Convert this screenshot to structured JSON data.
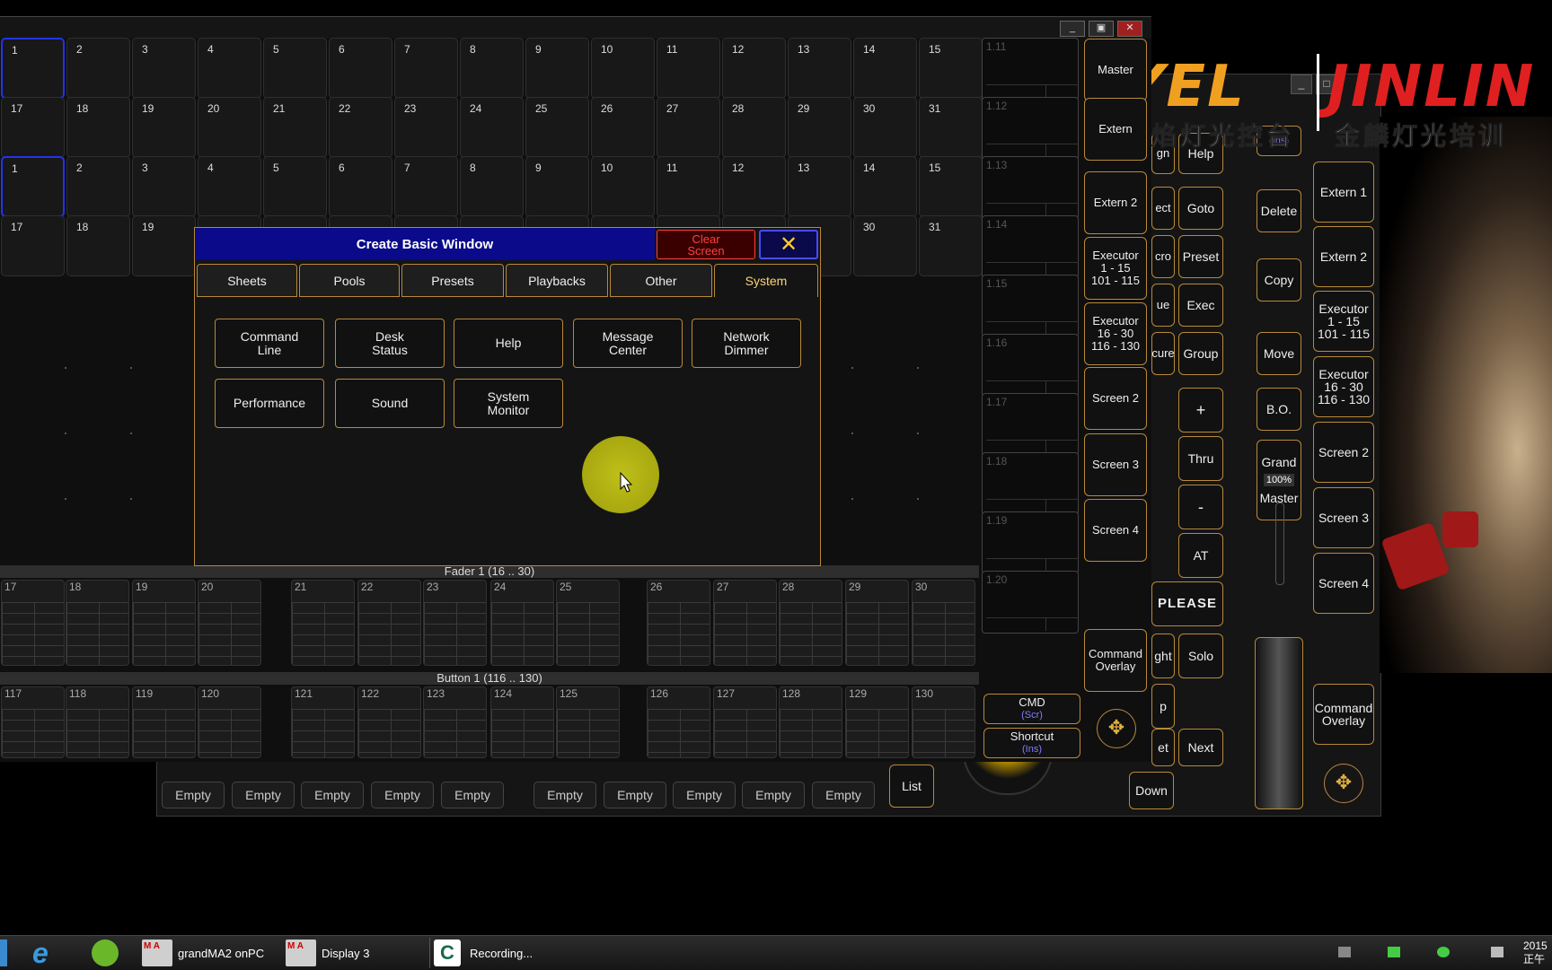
{
  "background_window": {
    "buttons": [
      {
        "label": "Master",
        "col": "a"
      },
      {
        "label": "Extern",
        "col": "a"
      },
      {
        "label": "Help",
        "col": "b"
      },
      {
        "label": "Delete",
        "col": "c"
      },
      {
        "label": "Extern 1",
        "col": "d"
      }
    ],
    "mid_labels": [
      "gn",
      "ect",
      "cro",
      "ue",
      "cure"
    ],
    "right_col": [
      "Help",
      "Goto",
      "Preset",
      "Exec",
      "Group",
      "+",
      "Thru",
      "-",
      "AT"
    ],
    "delete_col": [
      "Delete",
      "Copy",
      "Move",
      "B.O."
    ],
    "grand_master": {
      "top": "Grand",
      "pct": "100%",
      "bottom": "Master"
    },
    "extern_col": [
      "Extern 1",
      "Extern 2",
      "Executor\n1 - 15\n101 - 115",
      "Executor\n16 - 30\n116 - 130",
      "Screen 2",
      "Screen 3",
      "Screen 4"
    ],
    "command_overlay": "Command\nOverlay",
    "please": "PLEASE",
    "solo_row": [
      "ght",
      "Solo"
    ],
    "next_row": [
      "et",
      "Next"
    ],
    "p_label": "p",
    "down": "Down",
    "list": "List",
    "ins_label": "(Ins)",
    "macros_label": "Macros",
    "empty_label": "Empty",
    "empty_count": 10
  },
  "logo": {
    "left_big": "YEL",
    "right_big": "JINLIN",
    "left_sub": "领焰灯光控台",
    "right_sub": "金麟灯光培训"
  },
  "main_window": {
    "grid_rows": [
      [
        "1",
        "2",
        "3",
        "4",
        "5",
        "6",
        "7",
        "8",
        "9",
        "10",
        "11",
        "12",
        "13",
        "14",
        "15"
      ],
      [
        "17",
        "18",
        "19",
        "20",
        "21",
        "22",
        "23",
        "24",
        "25",
        "26",
        "27",
        "28",
        "29",
        "30",
        "31"
      ],
      [
        "1",
        "2",
        "3",
        "4",
        "5",
        "6",
        "7",
        "8",
        "9",
        "10",
        "11",
        "12",
        "13",
        "14",
        "15"
      ],
      [
        "17",
        "18",
        "19",
        "",
        "",
        "",
        "",
        "",
        "",
        "",
        "",
        "",
        "",
        "30",
        "31"
      ]
    ],
    "executor_labels": [
      "1.11",
      "1.12",
      "1.13",
      "1.14",
      "1.15",
      "1.16",
      "1.17",
      "1.18",
      "1.19",
      "1.20"
    ],
    "side_buttons": [
      "Master",
      "Extern",
      "Extern 2",
      "Executor\n1 - 15\n101 - 115",
      "Executor\n16 - 30\n116 - 130",
      "Screen 2",
      "Screen 3",
      "Screen 4",
      "Command\nOverlay"
    ],
    "cmd": {
      "label": "CMD",
      "sub": "(Scr)"
    },
    "shortcut": {
      "label": "Shortcut",
      "sub": "(Ins)"
    },
    "fader_header": "Fader  1 (16 .. 30)",
    "fader_labels": [
      "17",
      "18",
      "19",
      "20",
      "21",
      "22",
      "23",
      "24",
      "25",
      "26",
      "27",
      "28",
      "29",
      "30"
    ],
    "button_header": "Button  1 (116 .. 130)",
    "button_labels": [
      "117",
      "118",
      "119",
      "120",
      "121",
      "122",
      "123",
      "124",
      "125",
      "126",
      "127",
      "128",
      "129",
      "130"
    ]
  },
  "dialog": {
    "title": "Create Basic Window",
    "clear_screen": "Clear\nScreen",
    "tabs": [
      "Sheets",
      "Pools",
      "Presets",
      "Playbacks",
      "Other",
      "System"
    ],
    "active_tab": "System",
    "buttons": [
      "Command\nLine",
      "Desk\nStatus",
      "Help",
      "Message\nCenter",
      "Network\nDimmer",
      "Performance",
      "Sound",
      "System\nMonitor"
    ]
  },
  "taskbar": {
    "items": [
      "grandMA2 onPC",
      "Display 3",
      "Recording..."
    ],
    "clock": "2015",
    "clock_sub": "正午"
  },
  "colors": {
    "accent": "#b8893a",
    "dialog_title_bg": "#0a0a8a",
    "clear_screen": "#ff4040",
    "active_tab_text": "#ffd27a",
    "selected_cell": "#2233ee",
    "cursor_highlight": "#c8c81a",
    "logo_orange": "#f0a020",
    "logo_red": "#e02020"
  },
  "icons": [
    "close-icon",
    "minimize-icon",
    "maximize-icon",
    "move-icon",
    "ie-icon",
    "cursor-icon"
  ]
}
